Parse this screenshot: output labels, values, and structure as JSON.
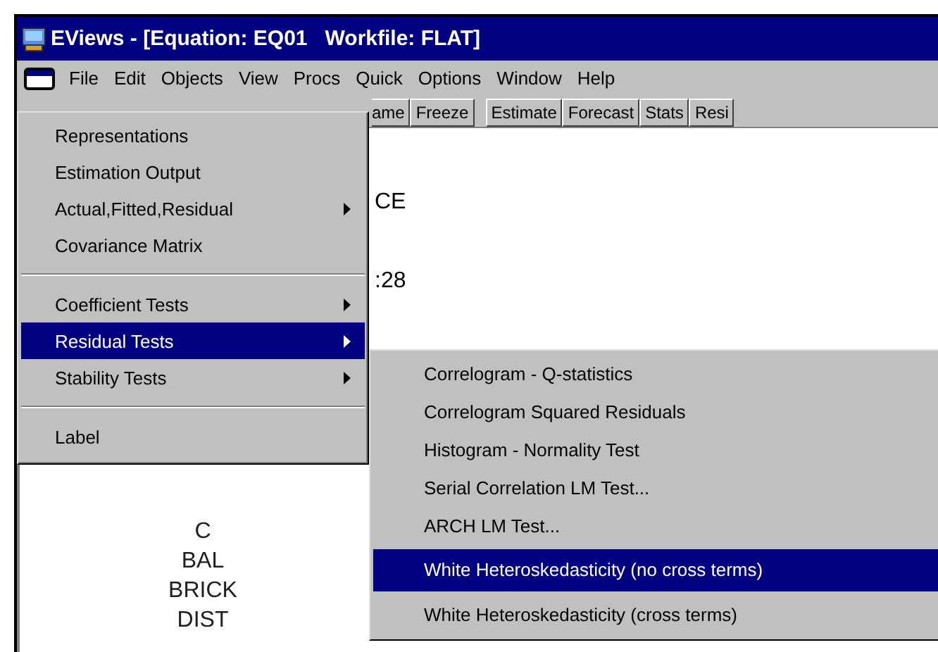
{
  "window": {
    "title": "EViews - [Equation: EQ01   Workfile: FLAT]"
  },
  "menu_bar": [
    {
      "label": "File"
    },
    {
      "label": "Edit"
    },
    {
      "label": "Objects"
    },
    {
      "label": "View"
    },
    {
      "label": "Procs"
    },
    {
      "label": "Quick"
    },
    {
      "label": "Options"
    },
    {
      "label": "Window"
    },
    {
      "label": "Help"
    }
  ],
  "toolbar": [
    "ame",
    "Freeze",
    "Estimate",
    "Forecast",
    "Stats",
    "Resi"
  ],
  "content_lines": [
    "CE",
    ":28"
  ],
  "variables": [
    "C",
    "BAL",
    "BRICK",
    "DIST"
  ],
  "view_menu": [
    {
      "kind": "item",
      "label": "Representations",
      "submenu": false,
      "selected": false
    },
    {
      "kind": "item",
      "label": "Estimation Output",
      "submenu": false,
      "selected": false
    },
    {
      "kind": "item",
      "label": "Actual,Fitted,Residual",
      "submenu": true,
      "selected": false
    },
    {
      "kind": "item",
      "label": "Covariance Matrix",
      "submenu": false,
      "selected": false
    },
    {
      "kind": "separator"
    },
    {
      "kind": "item",
      "label": "Coefficient Tests",
      "submenu": true,
      "selected": false
    },
    {
      "kind": "item",
      "label": "Residual Tests",
      "submenu": true,
      "selected": true
    },
    {
      "kind": "item",
      "label": "Stability Tests",
      "submenu": true,
      "selected": false
    },
    {
      "kind": "separator"
    },
    {
      "kind": "item",
      "label": "Label",
      "submenu": false,
      "selected": false
    }
  ],
  "residual_tests_menu": [
    {
      "label": "Correlogram - Q-statistics",
      "selected": false
    },
    {
      "label": "Correlogram Squared Residuals",
      "selected": false
    },
    {
      "label": "Histogram - Normality Test",
      "selected": false
    },
    {
      "label": "Serial Correlation LM Test...",
      "selected": false
    },
    {
      "label": "ARCH LM Test...",
      "selected": false
    },
    {
      "label": "White Heteroskedasticity (no cross terms)",
      "selected": true
    },
    {
      "label": "White Heteroskedasticity (cross terms)",
      "selected": false
    }
  ]
}
